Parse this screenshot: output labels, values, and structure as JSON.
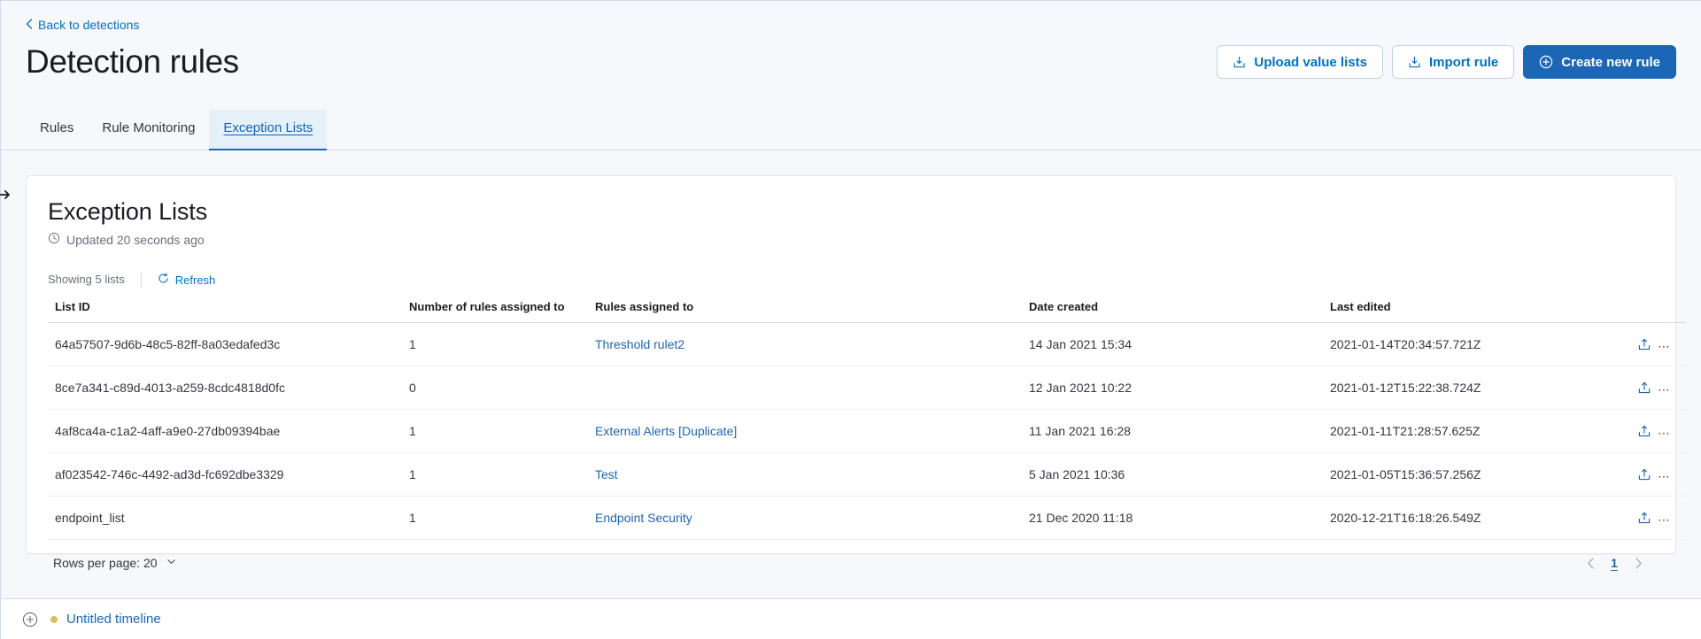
{
  "header": {
    "back_link": "Back to detections",
    "back_icon": "chevron-left-icon",
    "title": "Detection rules",
    "actions": [
      {
        "label": "Upload value lists",
        "icon": "import-icon",
        "style": "empty"
      },
      {
        "label": "Import rule",
        "icon": "import-icon",
        "style": "empty"
      },
      {
        "label": "Create new rule",
        "icon": "plus-in-circle-icon",
        "style": "primary"
      }
    ]
  },
  "tabs": [
    {
      "label": "Rules",
      "selected": false
    },
    {
      "label": "Rule Monitoring",
      "selected": false
    },
    {
      "label": "Exception Lists",
      "selected": true
    }
  ],
  "panel": {
    "title": "Exception Lists",
    "updated_icon": "clock-icon",
    "updated_text": "Updated 20 seconds ago",
    "showing": "Showing 5 lists",
    "refresh_label": "Refresh",
    "refresh_icon": "refresh-icon"
  },
  "table": {
    "columns": [
      "List ID",
      "Number of rules assigned to",
      "Rules assigned to",
      "Date created",
      "Last edited"
    ],
    "rows": [
      {
        "list_id": "64a57507-9d6b-48c5-82ff-8a03edafed3c",
        "num_rules": "1",
        "rules_assigned_to": "Threshold rulet2",
        "date_created": "14 Jan 2021 15:34",
        "last_edited": "2021-01-14T20:34:57.721Z",
        "export_enabled": true,
        "delete_enabled": true
      },
      {
        "list_id": "8ce7a341-c89d-4013-a259-8cdc4818d0fc",
        "num_rules": "0",
        "rules_assigned_to": "",
        "date_created": "12 Jan 2021 10:22",
        "last_edited": "2021-01-12T15:22:38.724Z",
        "export_enabled": true,
        "delete_enabled": true
      },
      {
        "list_id": "4af8ca4a-c1a2-4aff-a9e0-27db09394bae",
        "num_rules": "1",
        "rules_assigned_to": "External Alerts [Duplicate]",
        "date_created": "11 Jan 2021 16:28",
        "last_edited": "2021-01-11T21:28:57.625Z",
        "export_enabled": true,
        "delete_enabled": true
      },
      {
        "list_id": "af023542-746c-4492-ad3d-fc692dbe3329",
        "num_rules": "1",
        "rules_assigned_to": "Test",
        "date_created": "5 Jan 2021 10:36",
        "last_edited": "2021-01-05T15:36:57.256Z",
        "export_enabled": true,
        "delete_enabled": true
      },
      {
        "list_id": "endpoint_list",
        "num_rules": "1",
        "rules_assigned_to": "Endpoint Security",
        "date_created": "21 Dec 2020 11:18",
        "last_edited": "2020-12-21T16:18:26.549Z",
        "export_enabled": true,
        "delete_enabled": false
      }
    ],
    "action_icons": {
      "export": "export-icon",
      "delete": "trash-icon"
    }
  },
  "footer": {
    "rows_per_page_label": "Rows per page: 20",
    "rows_per_page_icon": "chevron-down-icon",
    "prev_icon": "chevron-left-icon",
    "next_icon": "chevron-right-icon",
    "current_page": "1"
  },
  "timeline": {
    "add_icon": "plus-in-circle-icon",
    "status_dot": "unsaved-dot",
    "name": "Untitled timeline"
  },
  "colors": {
    "accent": "#1b66b5",
    "link": "#0071c2",
    "danger": "#bd271e",
    "tab_selected_bg": "#e6f0f8",
    "page_bg": "#f7f8fc",
    "timeline_dot": "#d6bf57"
  }
}
